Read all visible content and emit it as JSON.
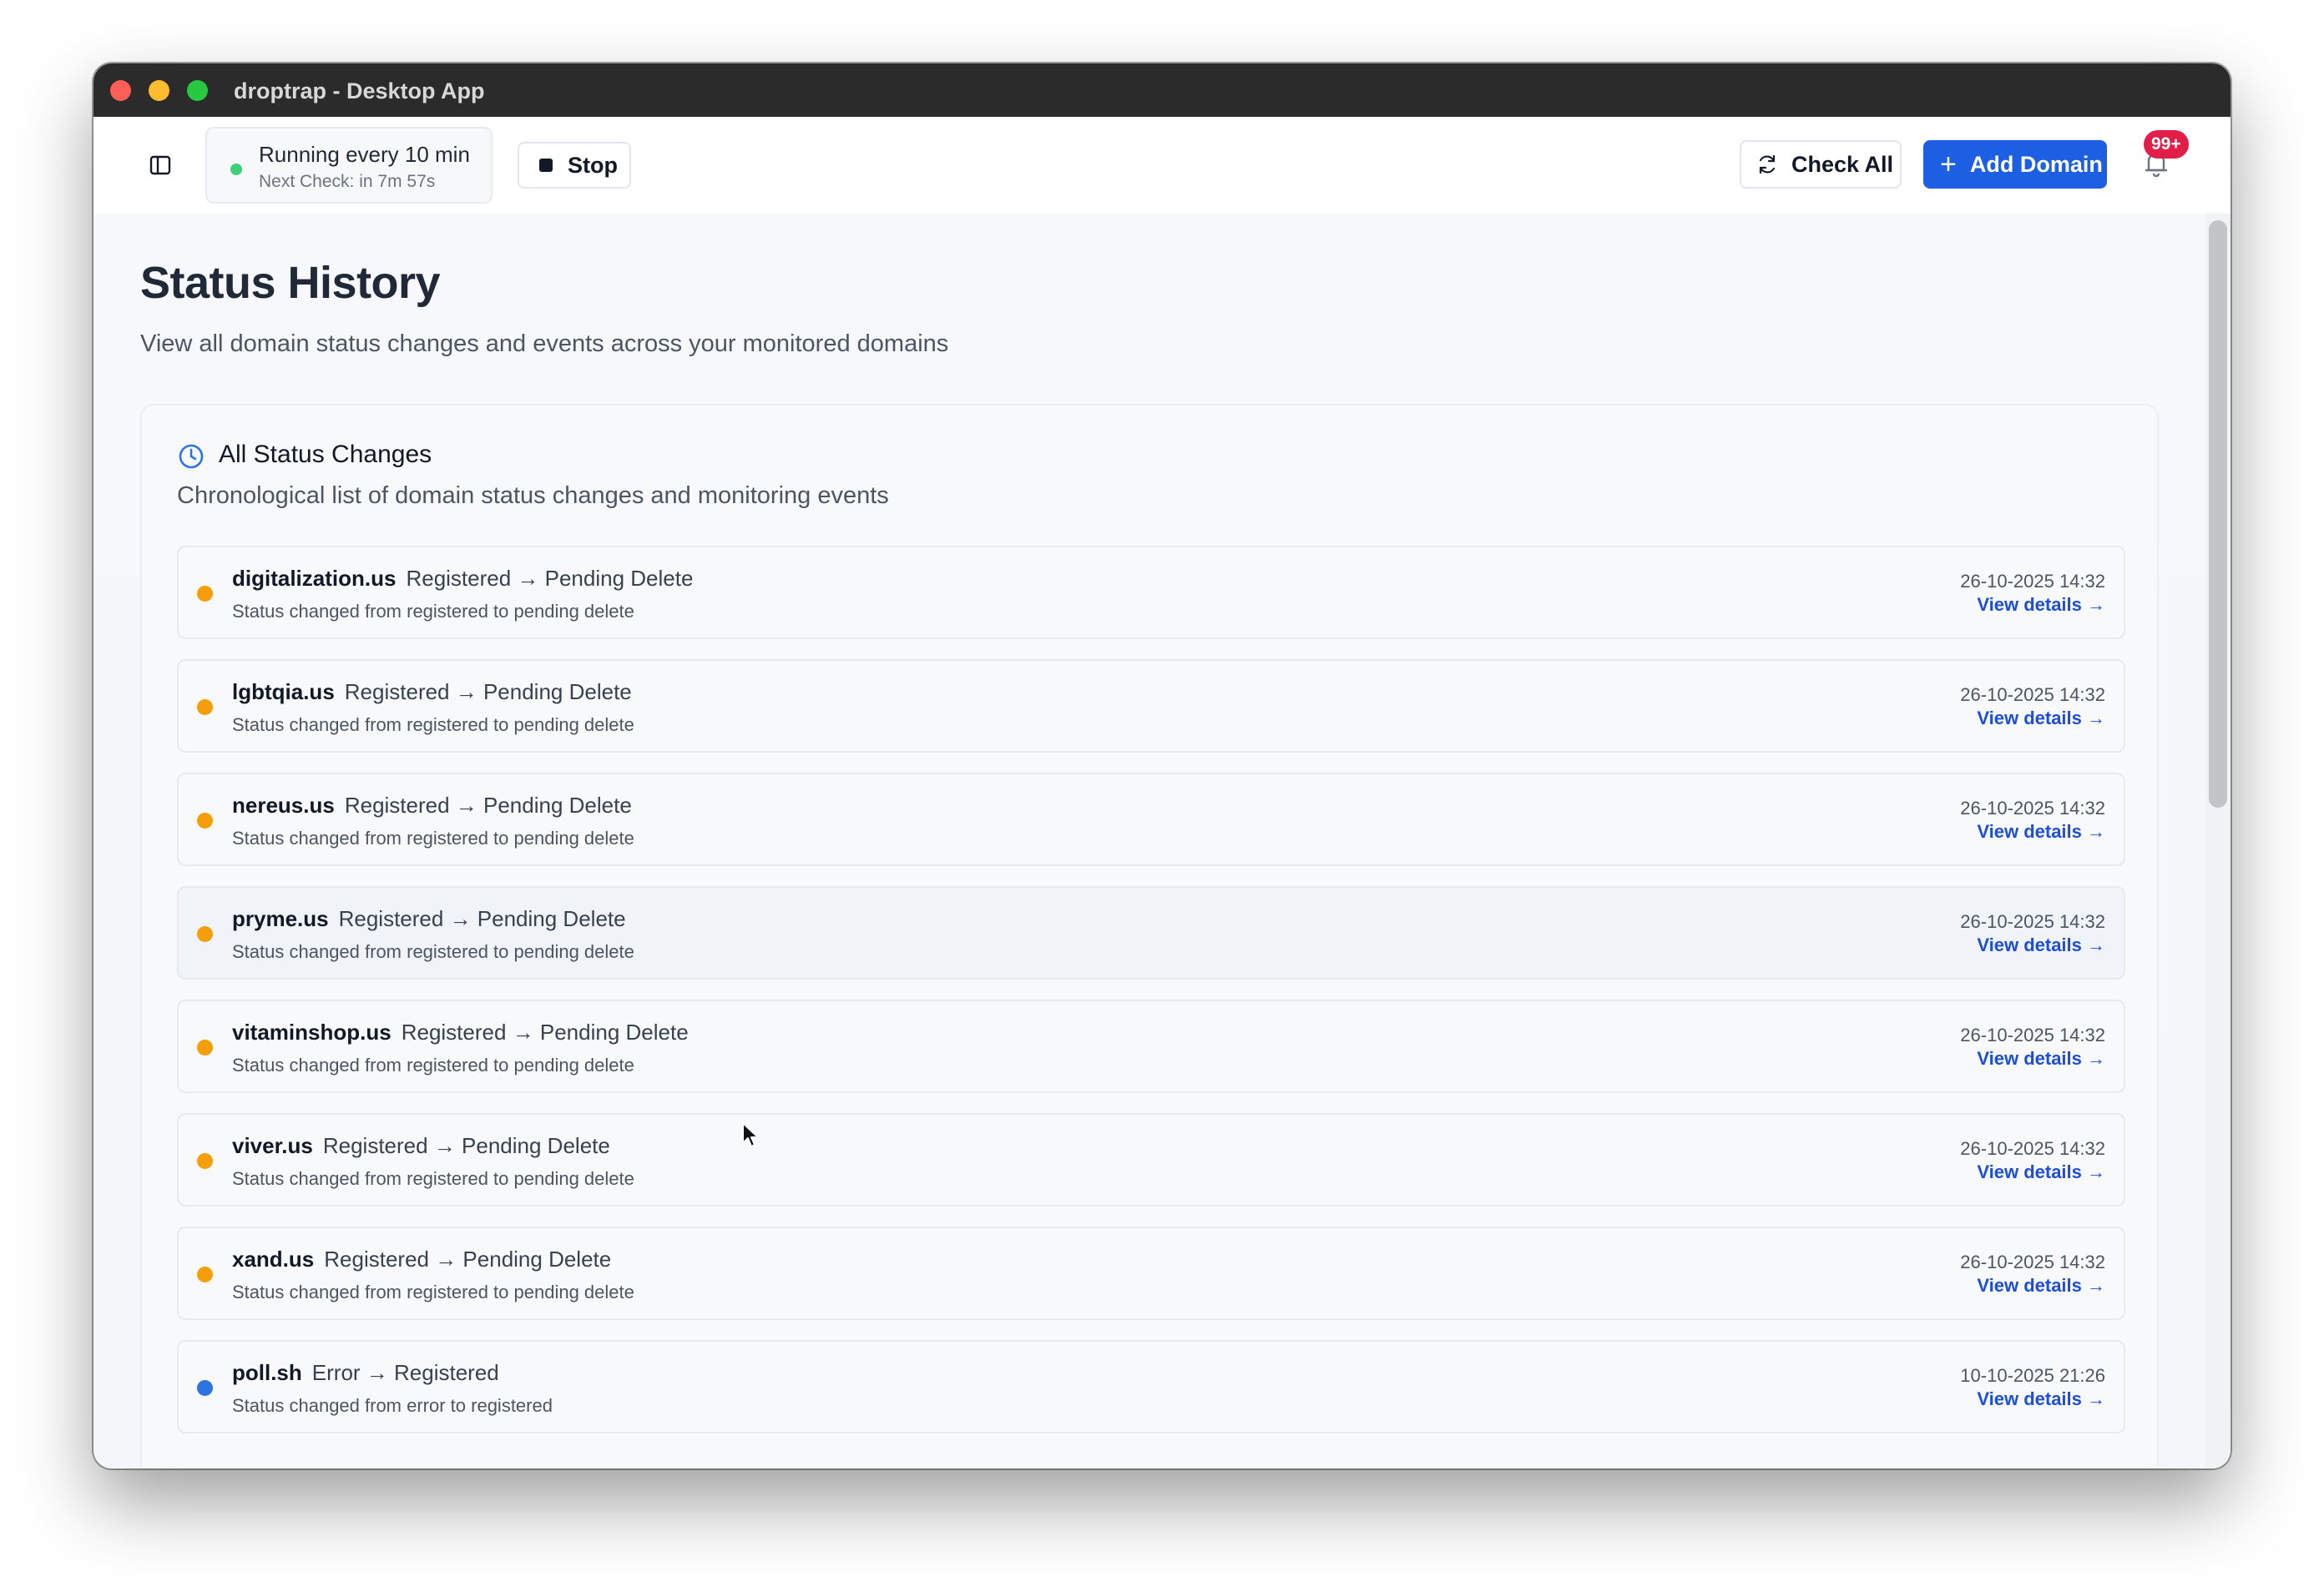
{
  "window": {
    "title": "droptrap - Desktop App"
  },
  "toolbar": {
    "status_title": "Running every 10 min",
    "status_sub": "Next Check: in 7m 57s",
    "stop_label": "Stop",
    "check_all_label": "Check All",
    "add_domain_label": "Add Domain",
    "add_plus": "+",
    "notification_badge": "99+"
  },
  "page": {
    "title": "Status History",
    "subtitle": "View all domain status changes and events across your monitored domains"
  },
  "card": {
    "title": "All Status Changes",
    "subtitle": "Chronological list of domain status changes and monitoring events"
  },
  "colors": {
    "pending_delete": "#f59e0b",
    "registered": "#2f73e0",
    "accent": "#1d5fe3"
  },
  "events": [
    {
      "domain": "digitalization.us",
      "change": "Registered → Pending Delete",
      "description": "Status changed from registered to pending delete",
      "timestamp": "26-10-2025 14:32",
      "link": "View details →",
      "status": "pending_delete"
    },
    {
      "domain": "lgbtqia.us",
      "change": "Registered → Pending Delete",
      "description": "Status changed from registered to pending delete",
      "timestamp": "26-10-2025 14:32",
      "link": "View details →",
      "status": "pending_delete"
    },
    {
      "domain": "nereus.us",
      "change": "Registered → Pending Delete",
      "description": "Status changed from registered to pending delete",
      "timestamp": "26-10-2025 14:32",
      "link": "View details →",
      "status": "pending_delete"
    },
    {
      "domain": "pryme.us",
      "change": "Registered → Pending Delete",
      "description": "Status changed from registered to pending delete",
      "timestamp": "26-10-2025 14:32",
      "link": "View details →",
      "status": "pending_delete"
    },
    {
      "domain": "vitaminshop.us",
      "change": "Registered → Pending Delete",
      "description": "Status changed from registered to pending delete",
      "timestamp": "26-10-2025 14:32",
      "link": "View details →",
      "status": "pending_delete"
    },
    {
      "domain": "viver.us",
      "change": "Registered → Pending Delete",
      "description": "Status changed from registered to pending delete",
      "timestamp": "26-10-2025 14:32",
      "link": "View details →",
      "status": "pending_delete"
    },
    {
      "domain": "xand.us",
      "change": "Registered → Pending Delete",
      "description": "Status changed from registered to pending delete",
      "timestamp": "26-10-2025 14:32",
      "link": "View details →",
      "status": "pending_delete"
    },
    {
      "domain": "poll.sh",
      "change": "Error → Registered",
      "description": "Status changed from error to registered",
      "timestamp": "10-10-2025 21:26",
      "link": "View details →",
      "status": "registered"
    }
  ]
}
